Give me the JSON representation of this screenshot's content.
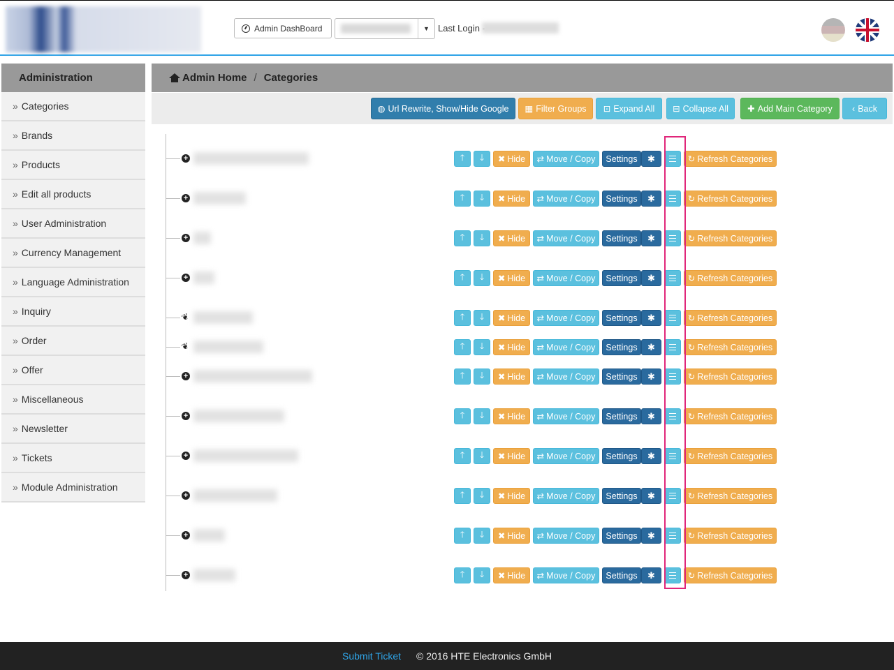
{
  "header": {
    "dashboard_label": "Admin DashBoard",
    "last_login_label": "Last Login -"
  },
  "sidebar": {
    "title": "Administration",
    "items": [
      "Categories",
      "Brands",
      "Products",
      "Edit all products",
      "User Administration",
      "Currency Management",
      "Language Administration",
      "Inquiry",
      "Order",
      "Offer",
      "Miscellaneous",
      "Newsletter",
      "Tickets",
      "Module Administration"
    ]
  },
  "breadcrumb": {
    "home": "Admin Home",
    "separator": "/",
    "current": "Categories"
  },
  "toolbar": {
    "url_rewrite": "Url Rewrite, Show/Hide Google",
    "filter_groups": "Filter Groups",
    "expand_all": "Expand All",
    "collapse_all": "Collapse All",
    "add_main": "Add Main Category",
    "back": "Back"
  },
  "row_labels": {
    "hide": "Hide",
    "move_copy": "Move / Copy",
    "settings": "Settings",
    "refresh": "Refresh Categories"
  },
  "footer": {
    "submit_ticket": "Submit Ticket",
    "copyright": "© 2016 HTE Electronics GmbH"
  },
  "colors": {
    "accent": "#2fa4e7",
    "orange": "#f0ad4e",
    "cyan": "#5bc0de",
    "green": "#5cb85c",
    "highlight": "#e0267a"
  }
}
